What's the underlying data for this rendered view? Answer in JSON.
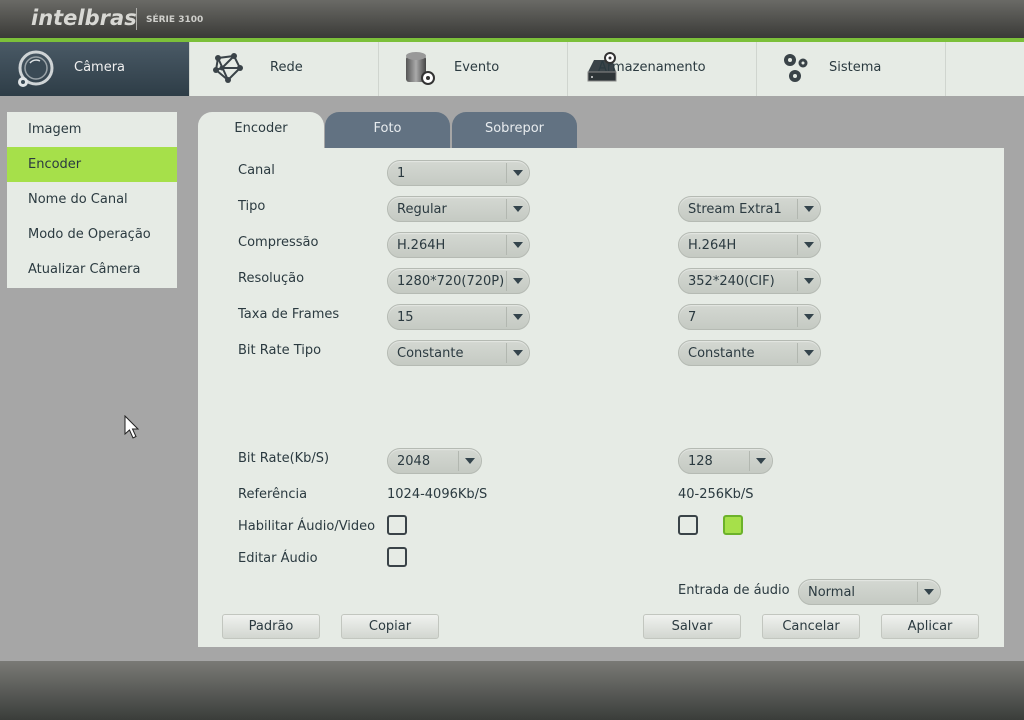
{
  "header": {
    "brand": "intelbras",
    "series": "SÉRIE 3100"
  },
  "nav": [
    {
      "label": "Câmera",
      "icon": "camera-lens-icon",
      "active": true
    },
    {
      "label": "Rede",
      "icon": "network-icon",
      "active": false
    },
    {
      "label": "Evento",
      "icon": "alarm-icon",
      "active": false
    },
    {
      "label": "Armazenamento",
      "icon": "hdd-icon",
      "active": false
    },
    {
      "label": "Sistema",
      "icon": "gears-icon",
      "active": false
    }
  ],
  "sidemenu": [
    {
      "label": "Imagem",
      "active": false
    },
    {
      "label": "Encoder",
      "active": true
    },
    {
      "label": "Nome do Canal",
      "active": false
    },
    {
      "label": "Modo de Operação",
      "active": false
    },
    {
      "label": "Atualizar Câmera",
      "active": false
    }
  ],
  "tabs": [
    {
      "label": "Encoder",
      "active": true
    },
    {
      "label": "Foto",
      "active": false
    },
    {
      "label": "Sobrepor",
      "active": false
    }
  ],
  "form": {
    "canal": {
      "label": "Canal",
      "value": "1"
    },
    "tipo": {
      "label": "Tipo",
      "main": "Regular",
      "extra": "Stream Extra1"
    },
    "compressao": {
      "label": "Compressão",
      "main": "H.264H",
      "extra": "H.264H"
    },
    "resolucao": {
      "label": "Resolução",
      "main": "1280*720(720P)",
      "extra": "352*240(CIF)"
    },
    "taxa": {
      "label": "Taxa de Frames",
      "main": "15",
      "extra": "7"
    },
    "bitrate_tipo": {
      "label": "Bit Rate Tipo",
      "main": "Constante",
      "extra": "Constante"
    },
    "bitrate": {
      "label": "Bit Rate(Kb/S)",
      "main": "2048",
      "extra": "128"
    },
    "referencia": {
      "label": "Referência",
      "main": "1024-4096Kb/S",
      "extra": "40-256Kb/S"
    },
    "habilitar": {
      "label": "Habilitar Áudio/Video",
      "main_checked": false,
      "extra_checked": false,
      "extra2_checked": true
    },
    "editar_audio": {
      "label": "Editar Áudio",
      "checked": false
    },
    "entrada_audio": {
      "label": "Entrada de áudio",
      "value": "Normal"
    }
  },
  "buttons": {
    "padrao": "Padrão",
    "copiar": "Copiar",
    "salvar": "Salvar",
    "cancelar": "Cancelar",
    "aplicar": "Aplicar"
  },
  "colors": {
    "accent_green": "#a6e04a",
    "header_line": "#7cc03a",
    "active_nav": "#3a4a55",
    "inactive_tab": "#627282"
  }
}
